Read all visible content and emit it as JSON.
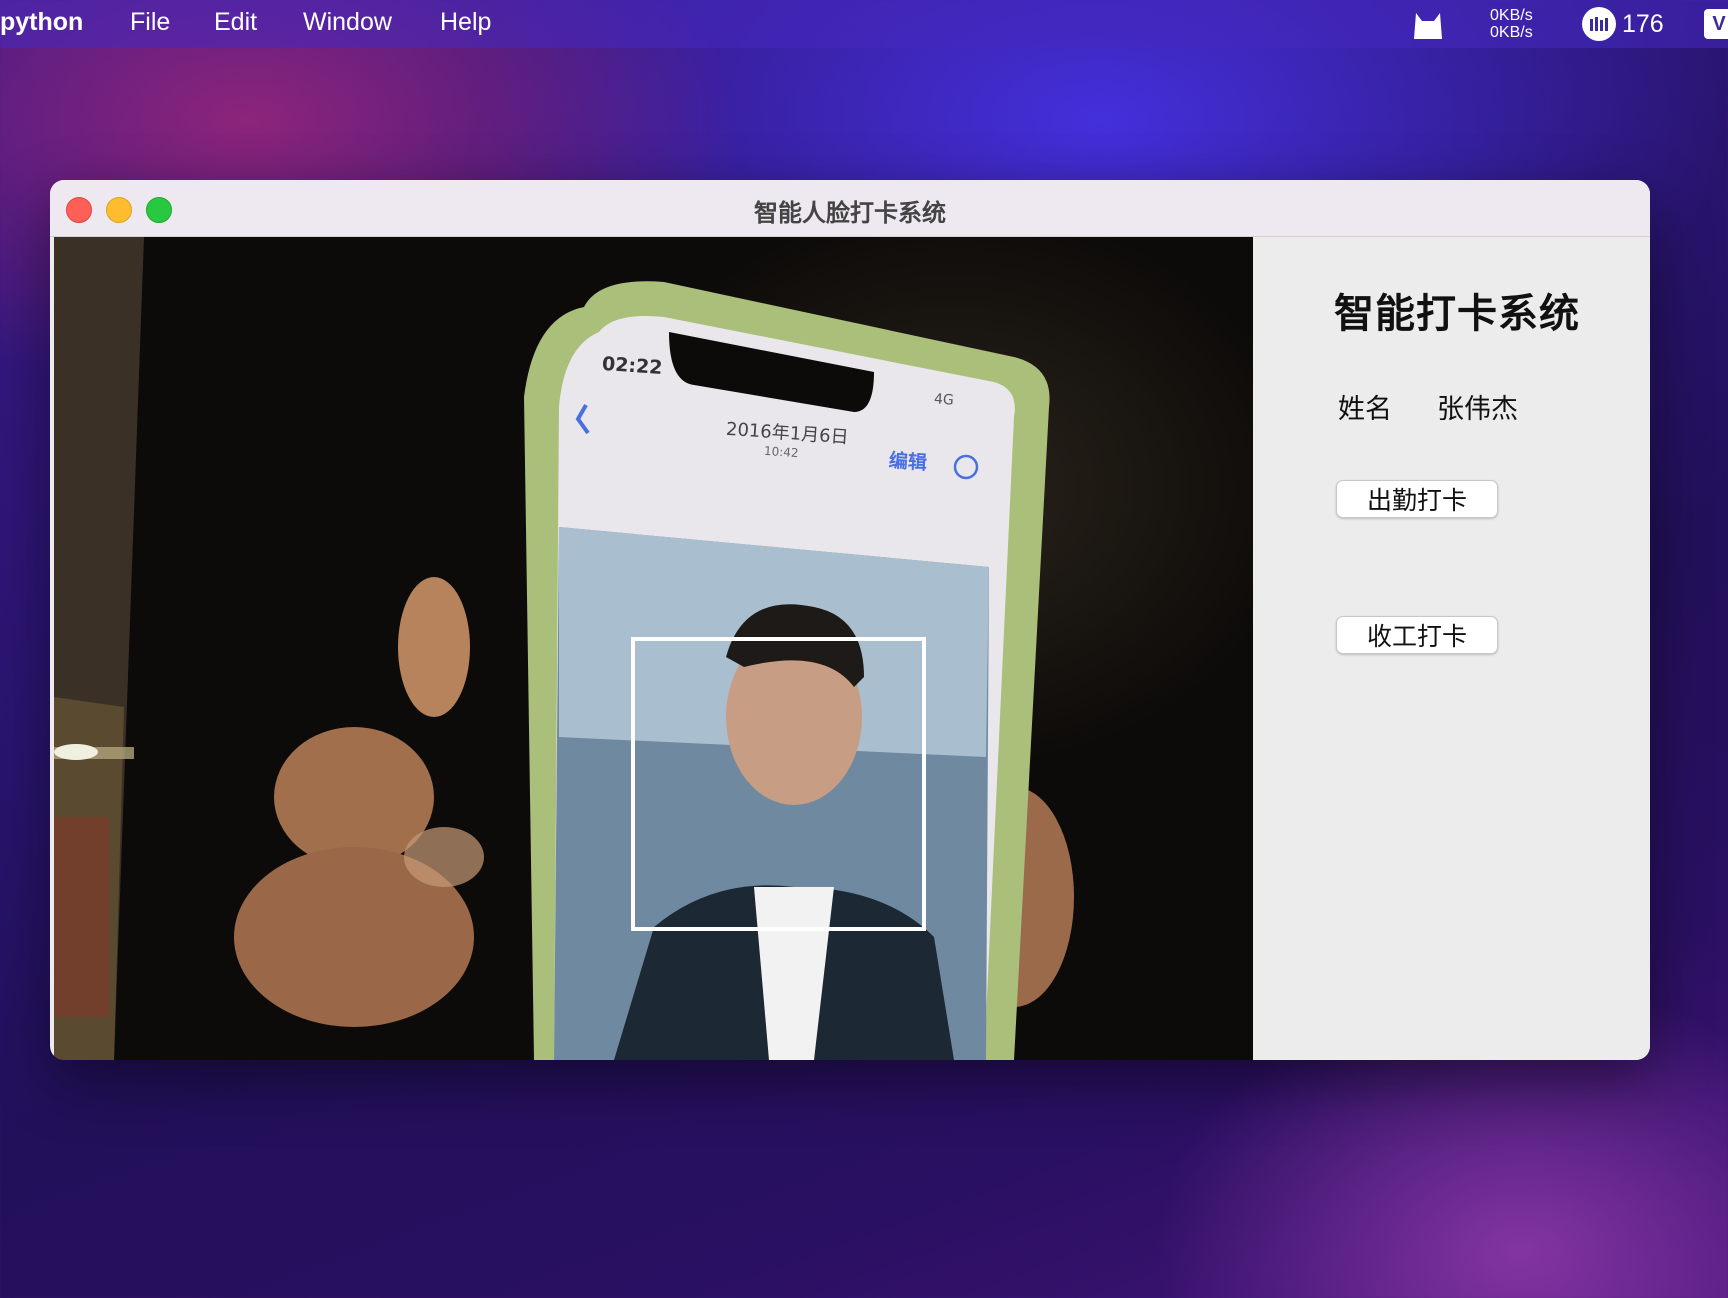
{
  "menubar": {
    "app_name": "python",
    "menus": [
      "File",
      "Edit",
      "Window",
      "Help"
    ],
    "net_up": "0KB/s",
    "net_down": "0KB/s",
    "badge_count": "176"
  },
  "window": {
    "title": "智能人脸打卡系统"
  },
  "camera": {
    "phone_time": "02:22",
    "phone_signal": "4G",
    "phone_date": "2016年1月6日",
    "phone_subtime": "10:42",
    "phone_edit": "编辑"
  },
  "panel": {
    "title": "智能打卡系统",
    "name_label": "姓名",
    "name_value": "张伟杰",
    "clock_in_label": "出勤打卡",
    "clock_out_label": "收工打卡"
  }
}
